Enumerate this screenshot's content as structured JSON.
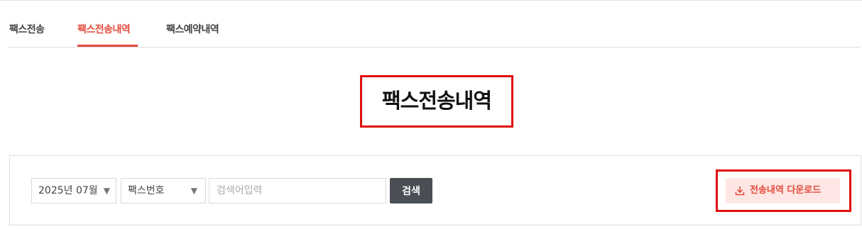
{
  "tabs": [
    {
      "label": "팩스전송",
      "active": false
    },
    {
      "label": "팩스전송내역",
      "active": true
    },
    {
      "label": "팩스예약내역",
      "active": false
    }
  ],
  "page": {
    "title": "팩스전송내역"
  },
  "filters": {
    "month": {
      "value": "2025년 07월",
      "arrow": "▼"
    },
    "type": {
      "value": "팩스번호",
      "arrow": "▼"
    },
    "search": {
      "placeholder": "검색어입력",
      "value": ""
    },
    "search_label": "검색"
  },
  "download": {
    "label": "전송내역 다운로드",
    "icon": "download-icon"
  },
  "colors": {
    "accent": "#e24a3b",
    "highlight_box": "#e00f0f",
    "search_button": "#4a4f55",
    "download_bg": "#fde6e3"
  }
}
